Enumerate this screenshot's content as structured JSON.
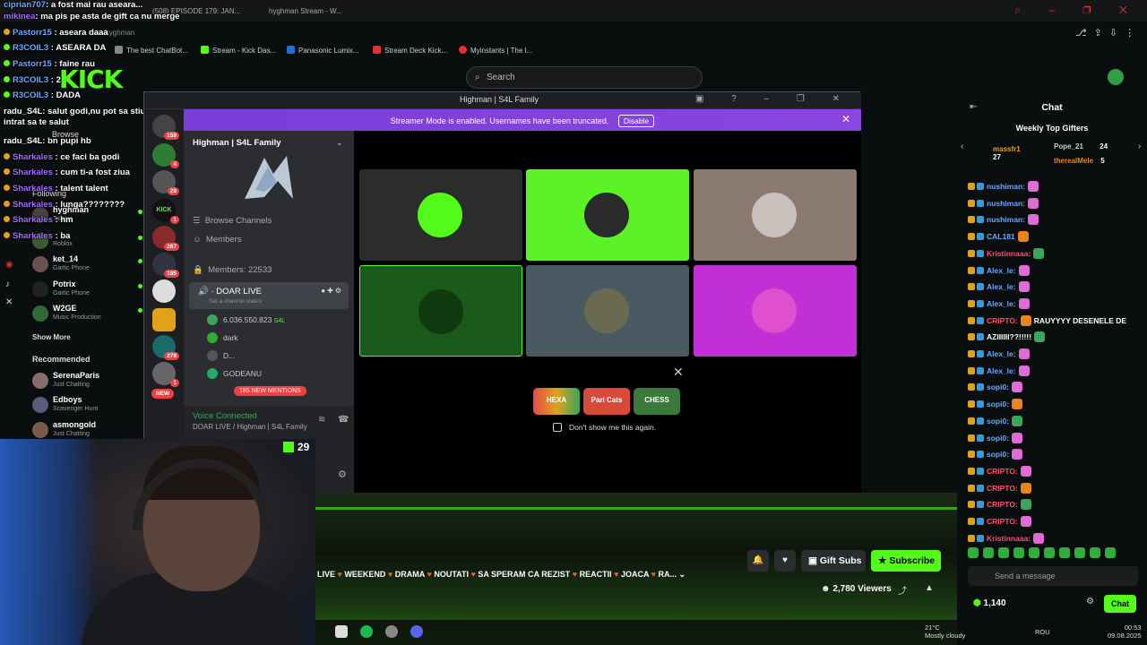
{
  "browser": {
    "tab_title": "hyghman Stream - W...",
    "tab_title2": "(508) EPISODE 179: JAN...",
    "url_fragment": "com/hyghman",
    "bookmarks": [
      "The best ChatBot...",
      "Stream - Kick Das...",
      "Panasonic Lumix...",
      "Stream Deck Kick...",
      "Myinstants | The l..."
    ]
  },
  "kick": {
    "logo": "KICK",
    "search_placeholder": "Search"
  },
  "overlay_chat": [
    {
      "user": "ciprian707",
      "text": "a fost mai rau aseara..."
    },
    {
      "user": "mikinea",
      "text": "ma pis pe asta de gift ca nu merge"
    },
    {
      "user": "Pastorr15",
      "text": "aseara daaa"
    },
    {
      "user": "R3COIL3",
      "text": "ASEARA DA"
    },
    {
      "user": "Pastorr15",
      "text": "faine rau"
    },
    {
      "user": "R3COIL3",
      "text": "2"
    },
    {
      "user": "R3COIL3",
      "text": "DADA"
    },
    {
      "user": "radu_S4L",
      "text": "salut godi,nu pot sa stiu pe live ca maine ma trezesc devreme,am intrat sa te salut"
    },
    {
      "user": "radu_S4L",
      "text": "bn pupi hb"
    },
    {
      "user": "Sharkales",
      "text": "ce faci ba godi"
    },
    {
      "user": "Sharkales",
      "text": "cum ti-a fost ziua"
    },
    {
      "user": "Sharkales",
      "text": "talent talent"
    },
    {
      "user": "Sharkales",
      "text": "lunga????????"
    },
    {
      "user": "Sharkales",
      "text": "hm"
    },
    {
      "user": "Sharkales",
      "text": "ba"
    }
  ],
  "sidebar": {
    "browse": "Browse",
    "following": "Following",
    "channels": [
      {
        "name": "hyghman",
        "cat": "Talking"
      },
      {
        "name": "",
        "cat": "Roblox"
      },
      {
        "name": "ket_14",
        "cat": "Gartic Phone"
      },
      {
        "name": "Potrix",
        "cat": "Gartic Phone"
      },
      {
        "name": "W2GE",
        "cat": "Music Production"
      }
    ],
    "show_more": "Show More",
    "recommended": "Recommended",
    "recommended_channels": [
      {
        "name": "SerenaParis",
        "cat": "Just Chatting"
      },
      {
        "name": "Edboys",
        "cat": "Scavenger Hunt"
      },
      {
        "name": "asmongold",
        "cat": "Just Chatting"
      }
    ]
  },
  "discord": {
    "window_title": "Highman | S4L Family",
    "banner_text": "Streamer Mode is enabled. Usernames have been truncated.",
    "banner_button": "Disable",
    "server_name": "Highman | S4L Family",
    "browse_channels": "Browse Channels",
    "members": "Members",
    "members_count": "Members: 22533",
    "voice_channel": "DOAR LIVE",
    "channel_status": "Set a channel status",
    "voice_users": [
      "6.036.550.823",
      "dark",
      "D...",
      "GODEANU"
    ],
    "badge_s4l": "S4L",
    "mentions": "185 NEW MENTIONS",
    "voice_connected": "Voice Connected",
    "voice_location": "DOAR LIVE / Highman | S4L Family",
    "guild_badges": [
      "159",
      "4",
      "29",
      "1",
      "267",
      "185",
      "1",
      "278",
      "1"
    ],
    "new_badge": "NEW",
    "games": [
      "HEXA",
      "Pari Cats",
      "CHESS"
    ],
    "dont_show": "Don't show me this again."
  },
  "stream": {
    "kick_count": "29",
    "title_parts": [
      "LIVE",
      "WEEKEND",
      "DRAMA",
      "NOUTATI",
      "SA SPERAM CA REZIST",
      "REACTII",
      "JOACA",
      "RA..."
    ],
    "gift_subs": "Gift Subs",
    "subscribe": "Subscribe",
    "viewers": "2,780 Viewers"
  },
  "chat": {
    "title": "Chat",
    "weekly_top": "Weekly Top Gifters",
    "gifters": [
      {
        "name": "massfr1",
        "count": "27"
      },
      {
        "name": "Pope_21",
        "count": "24"
      },
      {
        "name": "therealMele",
        "count": "5"
      }
    ],
    "messages": [
      {
        "user": "nushiman:",
        "text": "",
        "color": "#6aa8ff"
      },
      {
        "user": "nushiman:",
        "text": "",
        "color": "#6aa8ff"
      },
      {
        "user": "nushiman:",
        "text": "",
        "color": "#6aa8ff"
      },
      {
        "user": "CAL181",
        "text": "",
        "color": "#6aa8ff"
      },
      {
        "user": "Kristinnaaa:",
        "text": "",
        "color": "#ff4d6d"
      },
      {
        "user": "Alex_le:",
        "text": "",
        "color": "#6aa8ff"
      },
      {
        "user": "Alex_le:",
        "text": "",
        "color": "#6aa8ff"
      },
      {
        "user": "Alex_le:",
        "text": "",
        "color": "#6aa8ff"
      },
      {
        "user": "CRIPTO:",
        "text": "RAUYYYY DESENELE DE",
        "color": "#ff4d6d"
      },
      {
        "user": "AZIIIIII??!!!!!",
        "text": "",
        "color": "#ffffff"
      },
      {
        "user": "Alex_le:",
        "text": "",
        "color": "#6aa8ff"
      },
      {
        "user": "Alex_le:",
        "text": "",
        "color": "#6aa8ff"
      },
      {
        "user": "sopi0:",
        "text": "",
        "color": "#6aa8ff"
      },
      {
        "user": "sopi0:",
        "text": "",
        "color": "#6aa8ff"
      },
      {
        "user": "sopi0:",
        "text": "",
        "color": "#6aa8ff"
      },
      {
        "user": "sopi0:",
        "text": "",
        "color": "#6aa8ff"
      },
      {
        "user": "sopi0:",
        "text": "",
        "color": "#6aa8ff"
      },
      {
        "user": "CRIPTO:",
        "text": "",
        "color": "#ff4d6d"
      },
      {
        "user": "CRIPTO:",
        "text": "",
        "color": "#ff4d6d"
      },
      {
        "user": "CRIPTO:",
        "text": "",
        "color": "#ff4d6d"
      },
      {
        "user": "CRIPTO:",
        "text": "",
        "color": "#ff4d6d"
      },
      {
        "user": "Kristinnaaa:",
        "text": "",
        "color": "#ff4d6d"
      }
    ],
    "send_placeholder": "Send a message",
    "kicks": "1,140",
    "chat_button": "Chat"
  },
  "taskbar": {
    "temp": "21°C",
    "weather": "Mostly cloudy",
    "lang": "ROU",
    "time": "00:53",
    "date": "09.08.2025"
  },
  "colors": {
    "kick_green": "#53fc18",
    "discord_banner": "#8b45e0",
    "tile_green": "#5cf228",
    "tile_magenta": "#c12fd6"
  }
}
